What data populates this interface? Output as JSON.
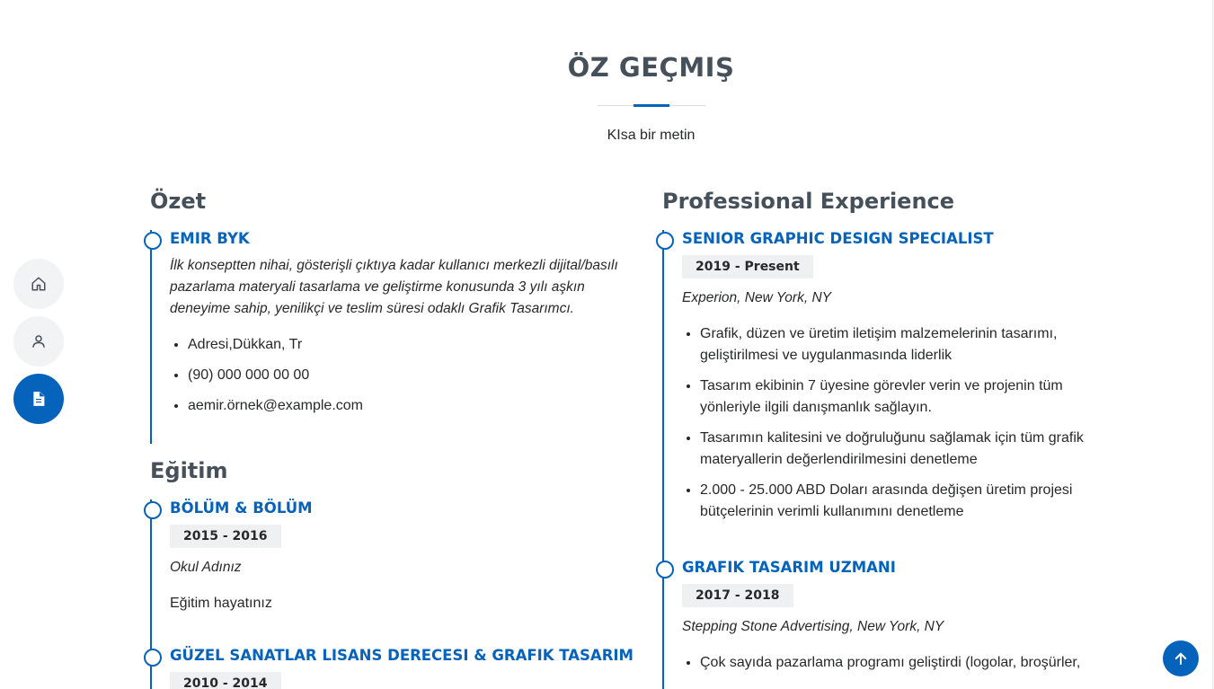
{
  "section": {
    "title": "ÖZ GEÇMIŞ",
    "subtitle": "KIsa bir metin"
  },
  "nav": {
    "items": [
      {
        "icon": "home-icon"
      },
      {
        "icon": "person-icon"
      },
      {
        "icon": "file-icon",
        "active": true
      }
    ]
  },
  "summary": {
    "heading": "Özet",
    "name": "EMIR BYK",
    "description": "İlk konseptten nihai, gösterişli çıktıya kadar kullanıcı merkezli dijital/basılı pazarlama materyali tasarlama ve geliştirme konusunda 3 yılı aşkın deneyime sahip, yenilikçi ve teslim süresi odaklı Grafik Tasarımcı.",
    "contacts": [
      "Adresi,Dükkan, Tr",
      "(90) 000 000 00 00",
      "aemir.örnek@example.com"
    ]
  },
  "education": {
    "heading": "Eğitim",
    "items": [
      {
        "title": "BÖLÜM & BÖLÜM",
        "period": "2015 - 2016",
        "school": "Okul Adınız",
        "text": "Eğitim hayatınız"
      },
      {
        "title": "GÜZEL SANATLAR LISANS DERECESI & GRAFIK TASARIM",
        "period": "2010 - 2014"
      }
    ]
  },
  "experience": {
    "heading": "Professional Experience",
    "items": [
      {
        "title": "SENIOR GRAPHIC DESIGN SPECIALIST",
        "period": "2019 - Present",
        "company": "Experion, New York, NY",
        "bullets": [
          "Grafik, düzen ve üretim iletişim malzemelerinin tasarımı, geliştirilmesi ve uygulanmasında liderlik",
          "Tasarım ekibinin 7 üyesine görevler verin ve projenin tüm yönleriyle ilgili danışmanlık sağlayın.",
          "Tasarımın kalitesini ve doğruluğunu sağlamak için tüm grafik materyallerin değerlendirilmesini denetleme",
          "2.000 - 25.000 ABD Doları arasında değişen üretim projesi bütçelerinin verimli kullanımını denetleme"
        ]
      },
      {
        "title": "GRAFIK TASARIM UZMANI",
        "period": "2017 - 2018",
        "company": "Stepping Stone Advertising, New York, NY",
        "bullets": [
          "Çok sayıda pazarlama programı geliştirdi (logolar, broşürler,"
        ]
      }
    ]
  },
  "colors": {
    "accent": "#0563bb",
    "heading": "#45505b",
    "badge_bg": "#eef0f2",
    "nav_bg": "#f2f3f5"
  }
}
